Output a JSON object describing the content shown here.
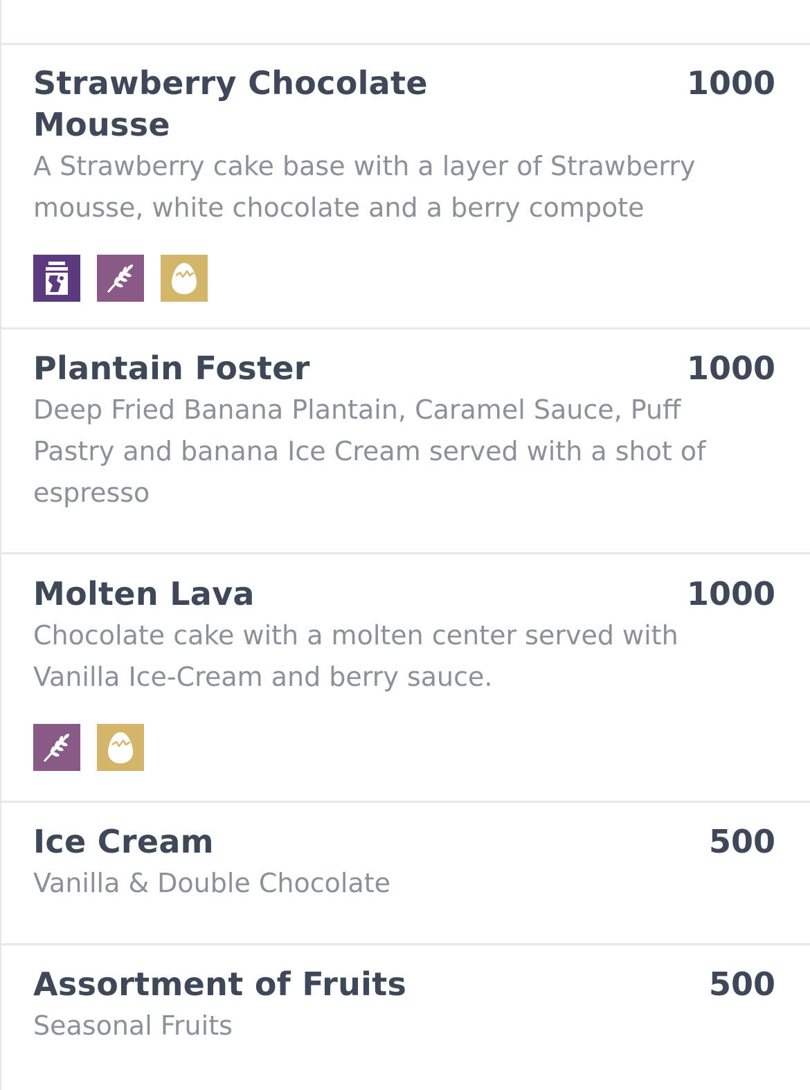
{
  "colors": {
    "milk": "#5c3a7e",
    "gluten": "#8a5a86",
    "egg": "#d4b66a",
    "title": "#3e4859",
    "description": "#8c9099",
    "divider": "#e6e8eb"
  },
  "items": [
    {
      "name": "Strawberry Chocolate Mousse",
      "price": "1000",
      "description": "A Strawberry cake base with a layer of Strawberry mousse, white chocolate and a berry compote",
      "allergens": [
        "milk-icon",
        "gluten-icon",
        "egg-icon"
      ]
    },
    {
      "name": "Plantain Foster",
      "price": "1000",
      "description": "Deep Fried Banana Plantain, Caramel Sauce, Puff Pastry and banana Ice Cream served with a shot of espresso",
      "allergens": []
    },
    {
      "name": "Molten Lava",
      "price": "1000",
      "description": "Chocolate cake with a molten center served with Vanilla Ice-Cream and berry sauce.",
      "allergens": [
        "gluten-icon",
        "egg-icon"
      ]
    },
    {
      "name": "Ice Cream",
      "price": "500",
      "description": "Vanilla & Double Chocolate",
      "allergens": []
    },
    {
      "name": "Assortment of Fruits",
      "price": "500",
      "description": "Seasonal Fruits",
      "allergens": []
    }
  ]
}
